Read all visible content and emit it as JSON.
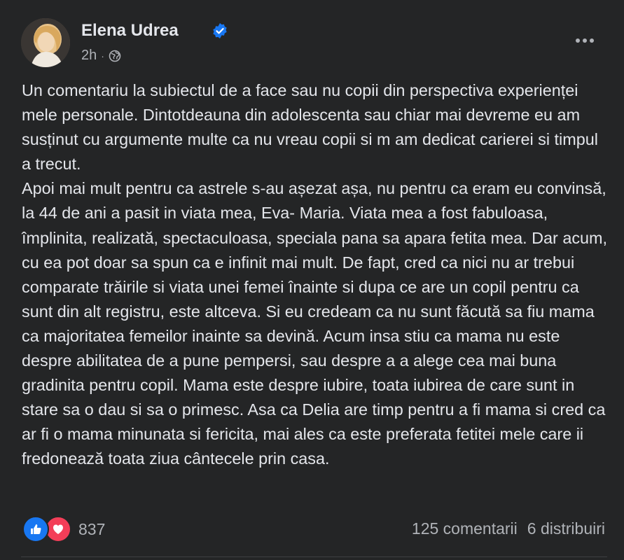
{
  "post": {
    "author": "Elena Udrea",
    "verified": true,
    "time": "2h",
    "dot": "·",
    "audience_icon": "globe-icon",
    "menu_icon": "more-horizontal-icon",
    "paragraphs": [
      "Un comentariu la subiectul de a face sau nu copii din perspectiva experienței mele personale. Dintotdeauna din adolescenta sau chiar mai devreme eu am susținut cu argumente multe ca nu vreau copii si m am dedicat carierei si timpul a trecut.",
      "Apoi mai mult pentru ca astrele s-au așezat așa, nu pentru ca eram eu convinsă, la 44 de ani a pasit in viata mea, Eva- Maria. Viata mea a fost fabuloasa, împlinita, realizată, spectaculoasa, speciala pana sa apara fetita mea. Dar acum, cu ea pot doar sa spun ca e infinit mai mult. De fapt, cred ca nici nu ar trebui comparate trăirile si viata unei femei înainte si dupa ce are un copil pentru ca sunt din alt registru, este altceva. Si eu credeam ca nu sunt făcută sa fiu  mama ca majoritatea femeilor inainte sa devină. Acum insa stiu ca mama nu este despre abilitatea de a pune pempersi, sau despre a  a alege cea mai buna gradinita pentru copil. Mama este despre iubire, toata iubirea de care sunt in stare sa o dau si sa o primesc. Asa ca Delia are timp pentru a fi mama si cred ca ar fi o mama minunata si fericita, mai ales ca este preferata fetitei mele care ii fredonează toata ziua cântecele prin casa."
    ]
  },
  "footer": {
    "reaction_icons": [
      "like-icon",
      "love-icon"
    ],
    "reaction_count": "837",
    "comments": "125 comentarii",
    "shares": "6 distribuiri"
  },
  "colors": {
    "background": "#242526",
    "text_primary": "#e4e6eb",
    "text_secondary": "#b0b3b8",
    "verified": "#1877f2",
    "like": "#1877f2",
    "love": "#f33e58"
  }
}
